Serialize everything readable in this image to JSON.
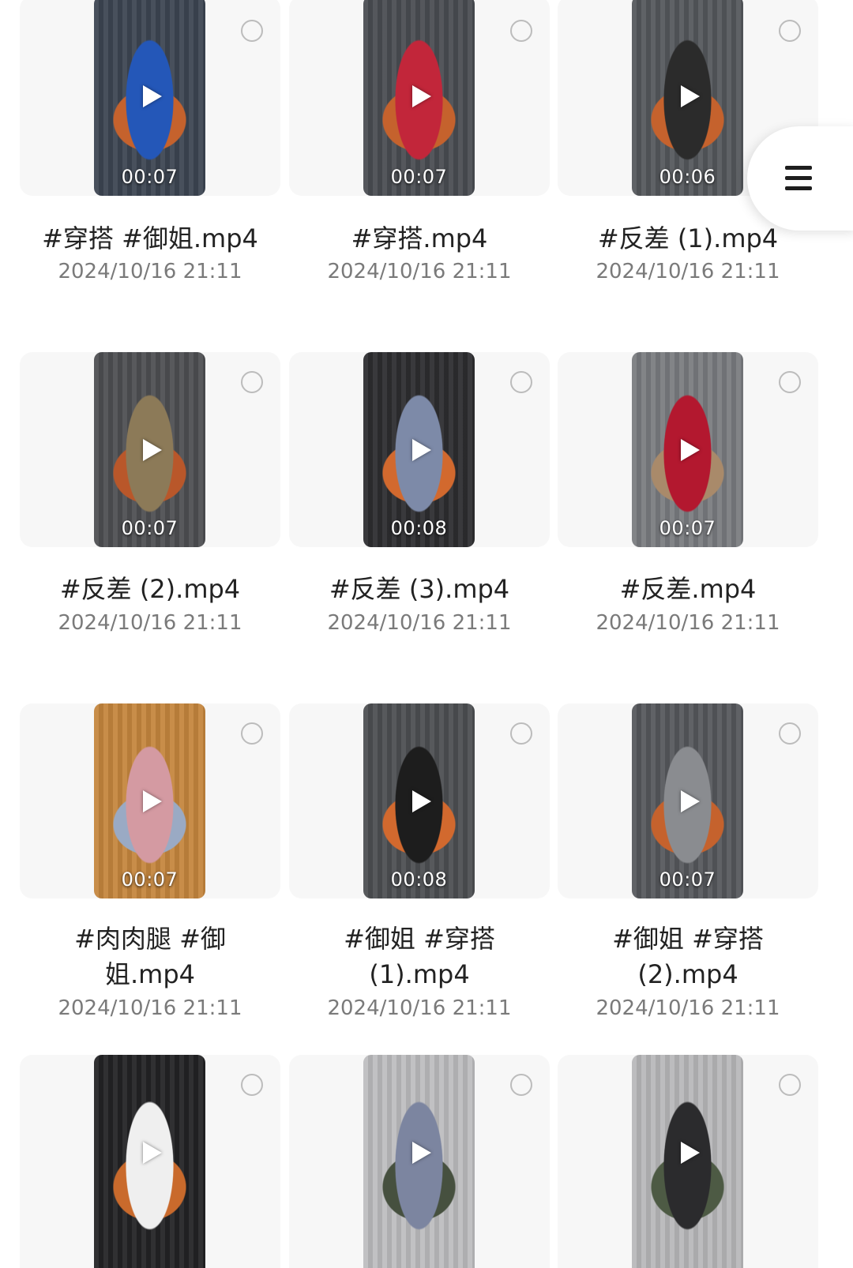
{
  "files": [
    {
      "name": "#穿搭 #御姐.mp4",
      "duration": "00:07",
      "date": "2024/10/16 21:11",
      "thumb": {
        "bg": "#3d4552",
        "accent": "#2457b8",
        "chair": "#c5622d"
      }
    },
    {
      "name": "#穿搭.mp4",
      "duration": "00:07",
      "date": "2024/10/16 21:11",
      "thumb": {
        "bg": "#4a4d52",
        "accent": "#c2263a",
        "chair": "#c5622d"
      }
    },
    {
      "name": "#反差 (1).mp4",
      "duration": "00:06",
      "date": "2024/10/16 21:11",
      "thumb": {
        "bg": "#55585c",
        "accent": "#2b2b2b",
        "chair": "#c5622d"
      }
    },
    {
      "name": "#反差 (2).mp4",
      "duration": "00:07",
      "date": "2024/10/16 21:11",
      "thumb": {
        "bg": "#4e4f52",
        "accent": "#8c7a58",
        "chair": "#b9572a"
      }
    },
    {
      "name": "#反差 (3).mp4",
      "duration": "00:08",
      "date": "2024/10/16 21:11",
      "thumb": {
        "bg": "#2d2d30",
        "accent": "#7d8aa8",
        "chair": "#d2692e"
      }
    },
    {
      "name": "#反差.mp4",
      "duration": "00:07",
      "date": "2024/10/16 21:11",
      "thumb": {
        "bg": "#7a7c80",
        "accent": "#b3182f",
        "chair": "#a98a6a"
      }
    },
    {
      "name": "#肉肉腿 #御姐.mp4",
      "duration": "00:07",
      "date": "2024/10/16 21:11",
      "thumb": {
        "bg": "#c5863e",
        "accent": "#d49aa2",
        "chair": "#9aaac4"
      }
    },
    {
      "name": "#御姐 #穿搭 (1).mp4",
      "duration": "00:08",
      "date": "2024/10/16 21:11",
      "thumb": {
        "bg": "#4d4f52",
        "accent": "#1d1d1d",
        "chair": "#d2692e"
      }
    },
    {
      "name": "#御姐 #穿搭 (2).mp4",
      "duration": "00:07",
      "date": "2024/10/16 21:11",
      "thumb": {
        "bg": "#56585c",
        "accent": "#8a8c90",
        "chair": "#c5622d"
      }
    },
    {
      "name": "",
      "duration": "",
      "date": "",
      "thumb": {
        "bg": "#232325",
        "accent": "#efefef",
        "chair": "#c96a2c"
      }
    },
    {
      "name": "",
      "duration": "",
      "date": "",
      "thumb": {
        "bg": "#bdbdbf",
        "accent": "#7c85a0",
        "chair": "#46503f"
      }
    },
    {
      "name": "",
      "duration": "",
      "date": "",
      "thumb": {
        "bg": "#b8b8ba",
        "accent": "#2b2b2d",
        "chair": "#4d5a44"
      }
    }
  ],
  "menu": {
    "icon": "menu-icon"
  }
}
